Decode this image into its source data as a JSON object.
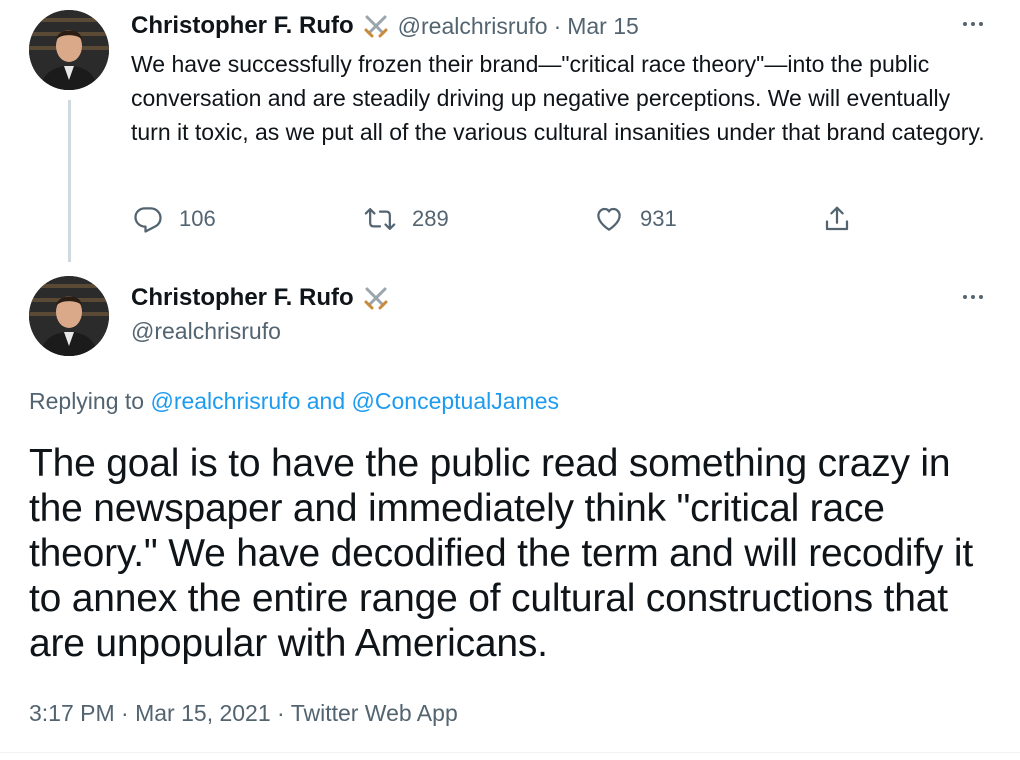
{
  "thread_tweet": {
    "author_name": "Christopher F. Rufo",
    "author_handle": "@realchrisrufo",
    "separator": "·",
    "date": "Mar 15",
    "text": "We have successfully frozen their brand—\"critical race theory\"—into the public conversation and are steadily driving up negative perceptions. We will eventually turn it toxic, as we put all of the various cultural insanities under that brand category.",
    "replies": "106",
    "retweets": "289",
    "likes": "931"
  },
  "main_tweet": {
    "author_name": "Christopher F. Rufo",
    "author_handle": "@realchrisrufo",
    "replying_prefix": "Replying to",
    "replying_user1": "@realchrisrufo",
    "replying_and": "and",
    "replying_user2": "@ConceptualJames",
    "text": "The goal is to have the public read something crazy in the newspaper and immediately think \"critical race theory.\" We have decodified the term and will recodify it to annex the entire range of cultural constructions that are unpopular with Americans.",
    "time": "3:17 PM",
    "separator": "·",
    "date": "Mar 15, 2021",
    "source": "Twitter Web App"
  },
  "icons": {
    "badge": "crossed-swords-icon",
    "more": "more-horizontal-icon",
    "reply": "reply-icon",
    "retweet": "retweet-icon",
    "like": "heart-icon",
    "share": "share-icon"
  },
  "colors": {
    "accent": "#1d9bf0",
    "secondary_text": "#536471",
    "primary_text": "#0f1419"
  }
}
